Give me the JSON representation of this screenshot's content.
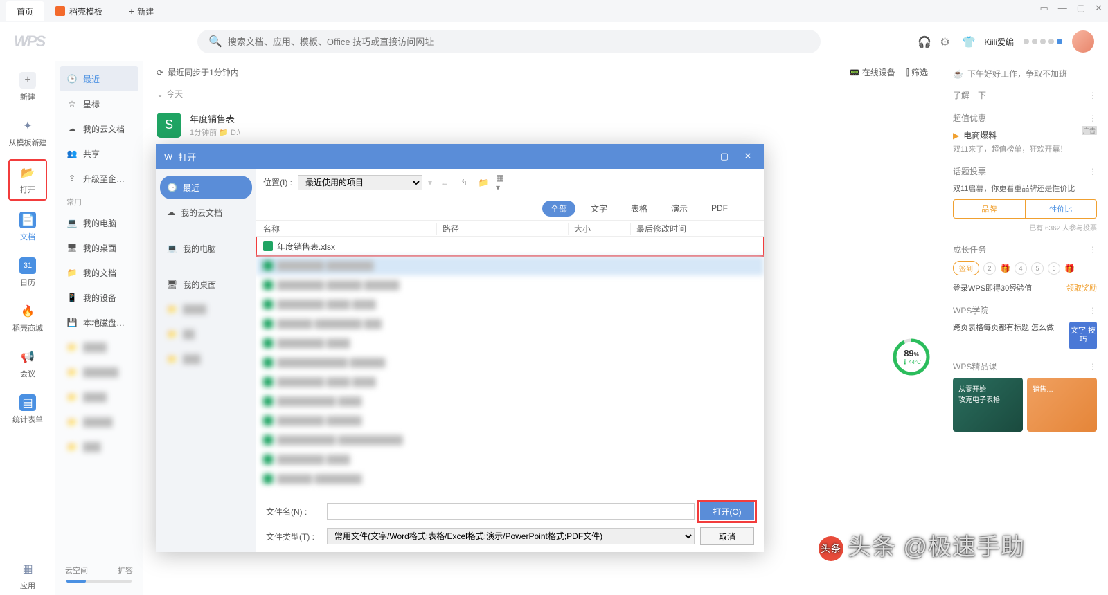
{
  "tabs": {
    "home": "首页",
    "template": "稻壳模板",
    "new": "新建"
  },
  "search": {
    "placeholder": "搜索文档、应用、模板、Office 技巧或直接访问网址"
  },
  "user": {
    "name": "Kiili爱编"
  },
  "iconSidebar": {
    "new": "新建",
    "fromTemplate": "从模板新建",
    "open": "打开",
    "docs": "文档",
    "calendar": "日历",
    "store": "稻壳商城",
    "meeting": "会议",
    "stats": "统计表单",
    "apps": "应用"
  },
  "navSidebar": {
    "recent": "最近",
    "star": "星标",
    "cloudDocs": "我的云文档",
    "share": "共享",
    "upgrade": "升级至企…",
    "section": "常用",
    "myComputer": "我的电脑",
    "myDesktop": "我的桌面",
    "myDocs": "我的文档",
    "myDevices": "我的设备",
    "localDisk": "本地磁盘…",
    "cloudSpace": "云空间",
    "expand": "扩容"
  },
  "content": {
    "sync": "最近同步于1分钟内",
    "onlineDevices": "在线设备",
    "filter": "筛选",
    "today": "今天",
    "file": {
      "name": "年度销售表",
      "meta": "1分钟前    📁  D:\\"
    }
  },
  "right": {
    "greeting": "下午好好工作，争取不加班",
    "learn": "了解一下",
    "promo": {
      "title": "超值优惠",
      "item": "电商爆料",
      "sub": "双11来了，超值榜单，狂欢开幕！",
      "ad": "广告"
    },
    "vote": {
      "title": "话题投票",
      "question": "双11启幕，你更看重品牌还是性价比",
      "left": "品牌",
      "right": "性价比",
      "count": "已有 6362 人参与投票"
    },
    "tasks": {
      "title": "成长任务",
      "signin": "签到",
      "nums": [
        "2",
        "4",
        "5",
        "6"
      ],
      "reward": "登录WPS即得30经验值",
      "claim": "领取奖励"
    },
    "academy": {
      "title": "WPS学院",
      "tip": "跨页表格每页都有标题 怎么做",
      "badge": "文字\n技巧"
    },
    "course": {
      "title": "WPS精品课",
      "c1a": "从零开始",
      "c1b": "攻克电子表格",
      "c2": "销售…"
    },
    "ring": {
      "pct": "89",
      "unit": "%",
      "temp": "44°C"
    }
  },
  "dialog": {
    "title": "打开",
    "side": {
      "recent": "最近",
      "cloud": "我的云文档",
      "computer": "我的电脑",
      "desktop": "我的桌面"
    },
    "toolbar": {
      "location": "位置(I) :",
      "locationValue": "最近使用的项目"
    },
    "filters": {
      "all": "全部",
      "text": "文字",
      "sheet": "表格",
      "slide": "演示",
      "pdf": "PDF"
    },
    "cols": {
      "name": "名称",
      "path": "路径",
      "size": "大小",
      "date": "最后修改时间"
    },
    "firstFile": "年度销售表.xlsx",
    "footer": {
      "fileName": "文件名(N) :",
      "fileType": "文件类型(T) :",
      "typeValue": "常用文件(文字/Word格式;表格/Excel格式;演示/PowerPoint格式;PDF文件)",
      "open": "打开(O)",
      "cancel": "取消"
    }
  },
  "watermark": "头条 @极速手助"
}
